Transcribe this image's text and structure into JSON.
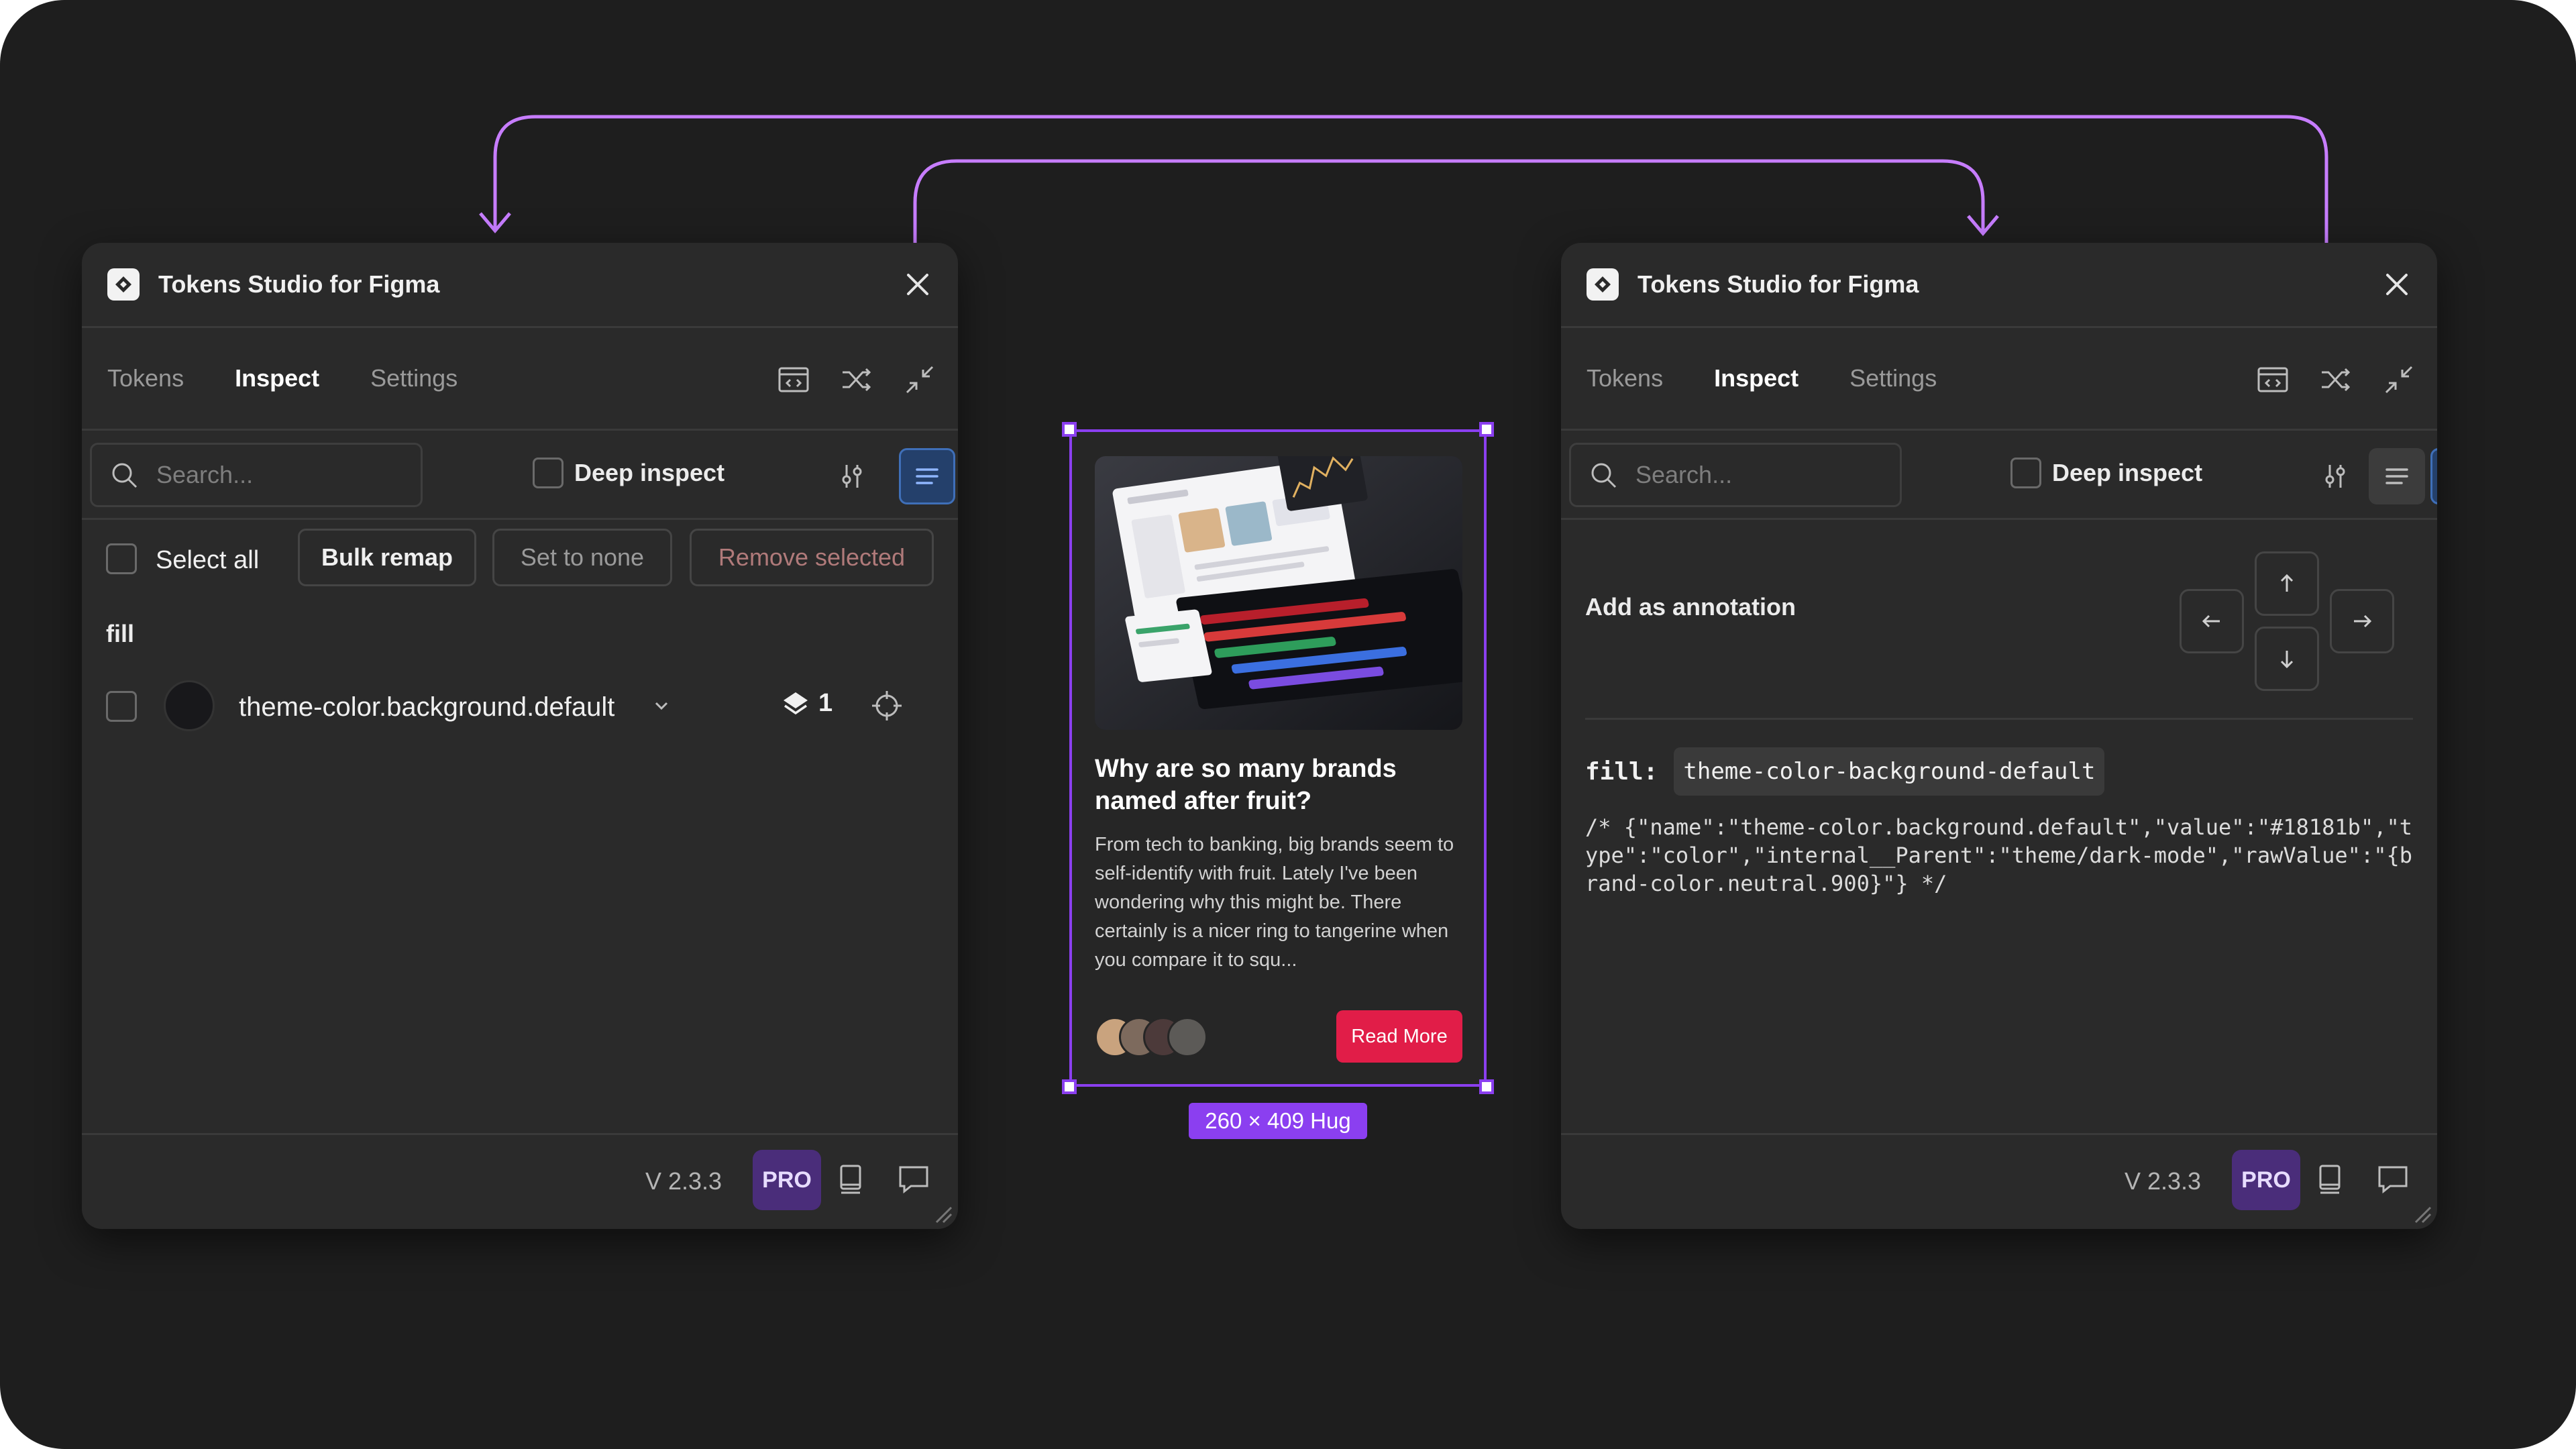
{
  "app": {
    "title": "Tokens Studio for Figma"
  },
  "tabs": [
    "Tokens",
    "Inspect",
    "Settings"
  ],
  "toolbar": {
    "search_placeholder": "Search...",
    "deep_inspect_label": "Deep inspect"
  },
  "actions": {
    "select_all": "Select all",
    "bulk_remap": "Bulk remap",
    "set_to_none": "Set to none",
    "remove_selected": "Remove selected"
  },
  "inspect": {
    "group": "fill",
    "token": {
      "name": "theme-color.background.default",
      "layer_count": "1",
      "swatch_color": "#18181b"
    }
  },
  "annotation": {
    "label": "Add as annotation",
    "fill_key": "fill:",
    "fill_value": "theme-color-background-default",
    "comment": "/* {\"name\":\"theme-color.background.default\",\"value\":\"#18181b\",\"type\":\"color\",\"internal__Parent\":\"theme/dark-mode\",\"rawValue\":\"{brand-color.neutral.900}\"} */"
  },
  "footer": {
    "version": "V 2.3.3",
    "badge": "PRO"
  },
  "card": {
    "title": "Why are so many brands named after fruit?",
    "body": "From tech to banking, big brands seem to self-identify with fruit. Lately I've been wondering why this might be. There certainly is a nicer ring to tangerine when you compare it to squ...",
    "button": "Read More"
  },
  "selection": {
    "dimensions": "260 × 409 Hug"
  },
  "colors": {
    "accent_purple": "#8b3ff0",
    "wire": "#c77dff",
    "read_more": "#e11d48",
    "active_blue": "#3f6fb8",
    "pro_bg": "#4a2d7a"
  }
}
